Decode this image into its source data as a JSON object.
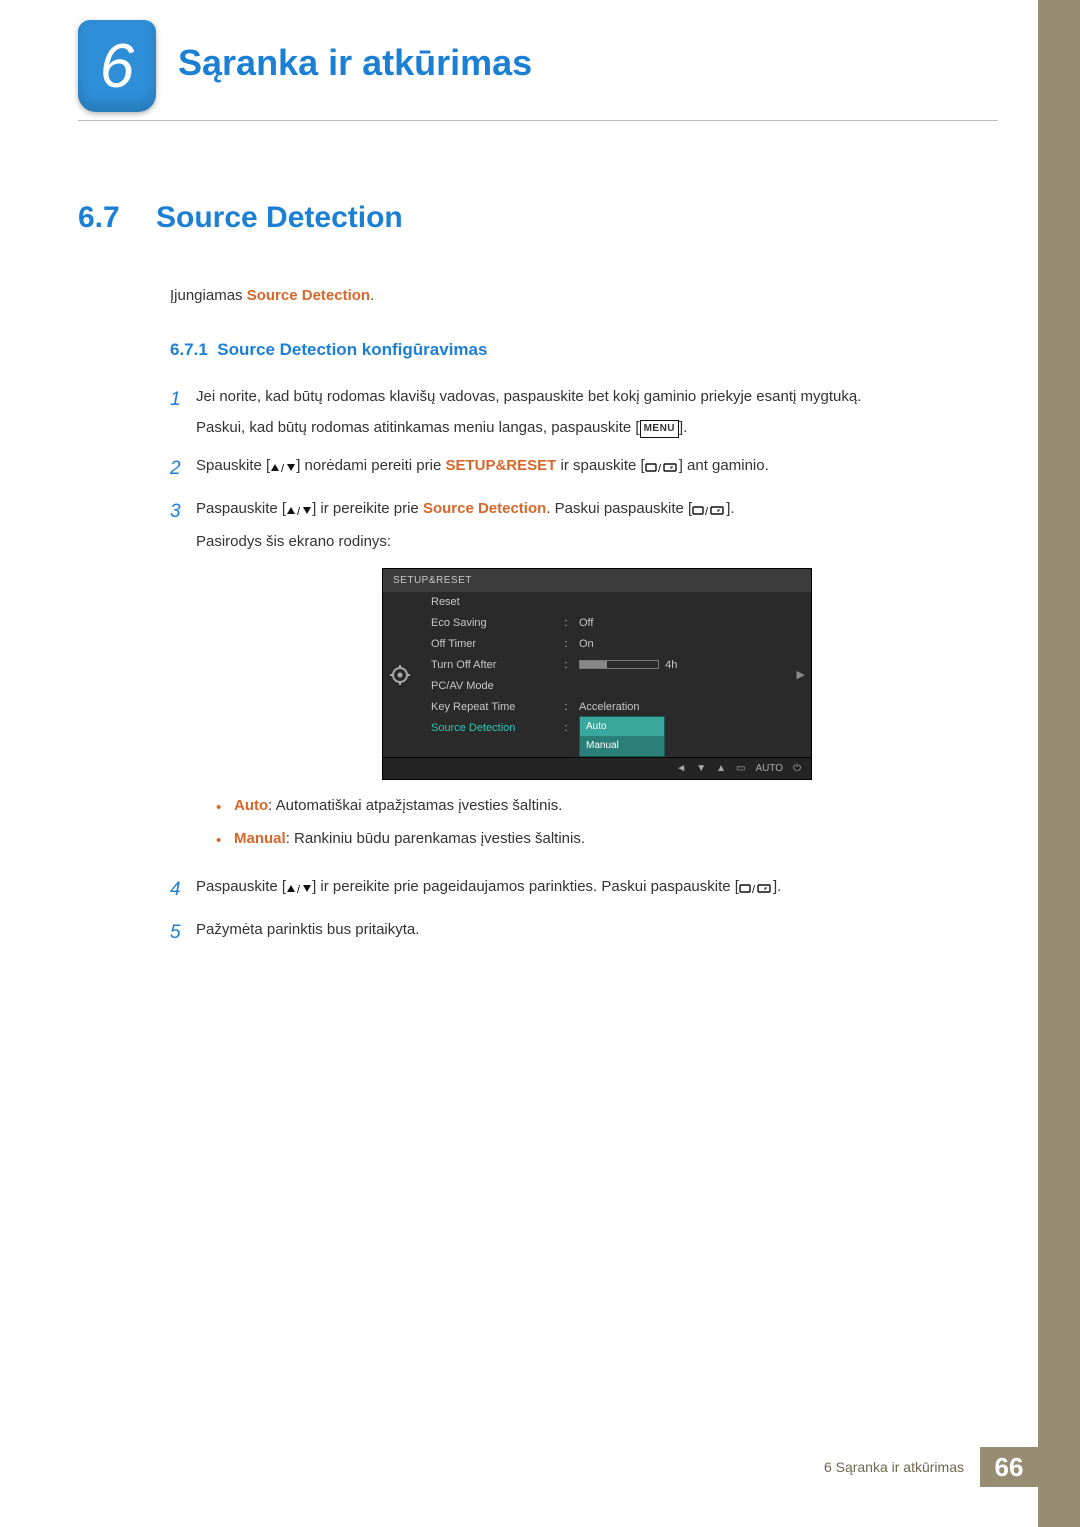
{
  "chapter": {
    "number": "6",
    "title": "Sąranka ir atkūrimas"
  },
  "section": {
    "number": "6.7",
    "title": "Source Detection"
  },
  "intro": {
    "prefix": "Įjungiamas ",
    "term": "Source Detection",
    "suffix": "."
  },
  "subsection": {
    "number": "6.7.1",
    "title": "Source Detection konfigūravimas"
  },
  "steps": {
    "s1": {
      "num": "1",
      "l1": "Jei norite, kad būtų rodomas klavišų vadovas, paspauskite bet kokį gaminio priekyje esantį mygtuką.",
      "l2a": "Paskui, kad būtų rodomas atitinkamas meniu langas, paspauskite [",
      "menu": "MENU",
      "l2b": "]."
    },
    "s2": {
      "num": "2",
      "a": "Spauskite [",
      "b": "] norėdami pereiti prie ",
      "setup": "SETUP&RESET",
      "c": " ir spauskite [",
      "d": "] ant gaminio."
    },
    "s3": {
      "num": "3",
      "a": "Paspauskite [",
      "b": "] ir pereikite prie ",
      "term": "Source Detection",
      "c": ". Paskui paspauskite [",
      "d": "].",
      "sub": "Pasirodys šis ekrano rodinys:"
    },
    "s4": {
      "num": "4",
      "a": "Paspauskite [",
      "b": "] ir pereikite prie pageidaujamos parinkties. Paskui paspauskite [",
      "c": "]."
    },
    "s5": {
      "num": "5",
      "txt": "Pažymėta parinktis bus pritaikyta."
    }
  },
  "bullets": {
    "auto": {
      "term": "Auto",
      "txt": ": Automatiškai atpažįstamas įvesties šaltinis."
    },
    "manual": {
      "term": "Manual",
      "txt": ": Rankiniu būdu parenkamas įvesties šaltinis."
    }
  },
  "osd": {
    "title": "SETUP&RESET",
    "rows": {
      "reset": "Reset",
      "eco": "Eco Saving",
      "eco_v": "Off",
      "off": "Off Timer",
      "off_v": "On",
      "turn": "Turn Off After",
      "turn_v": "4h",
      "pc": "PC/AV Mode",
      "key": "Key Repeat Time",
      "key_v": "Acceleration",
      "src": "Source Detection"
    },
    "dropdown": {
      "auto": "Auto",
      "manual": "Manual"
    },
    "footer": {
      "auto": "AUTO"
    }
  },
  "footer": {
    "text": "6 Sąranka ir atkūrimas",
    "page": "66"
  }
}
